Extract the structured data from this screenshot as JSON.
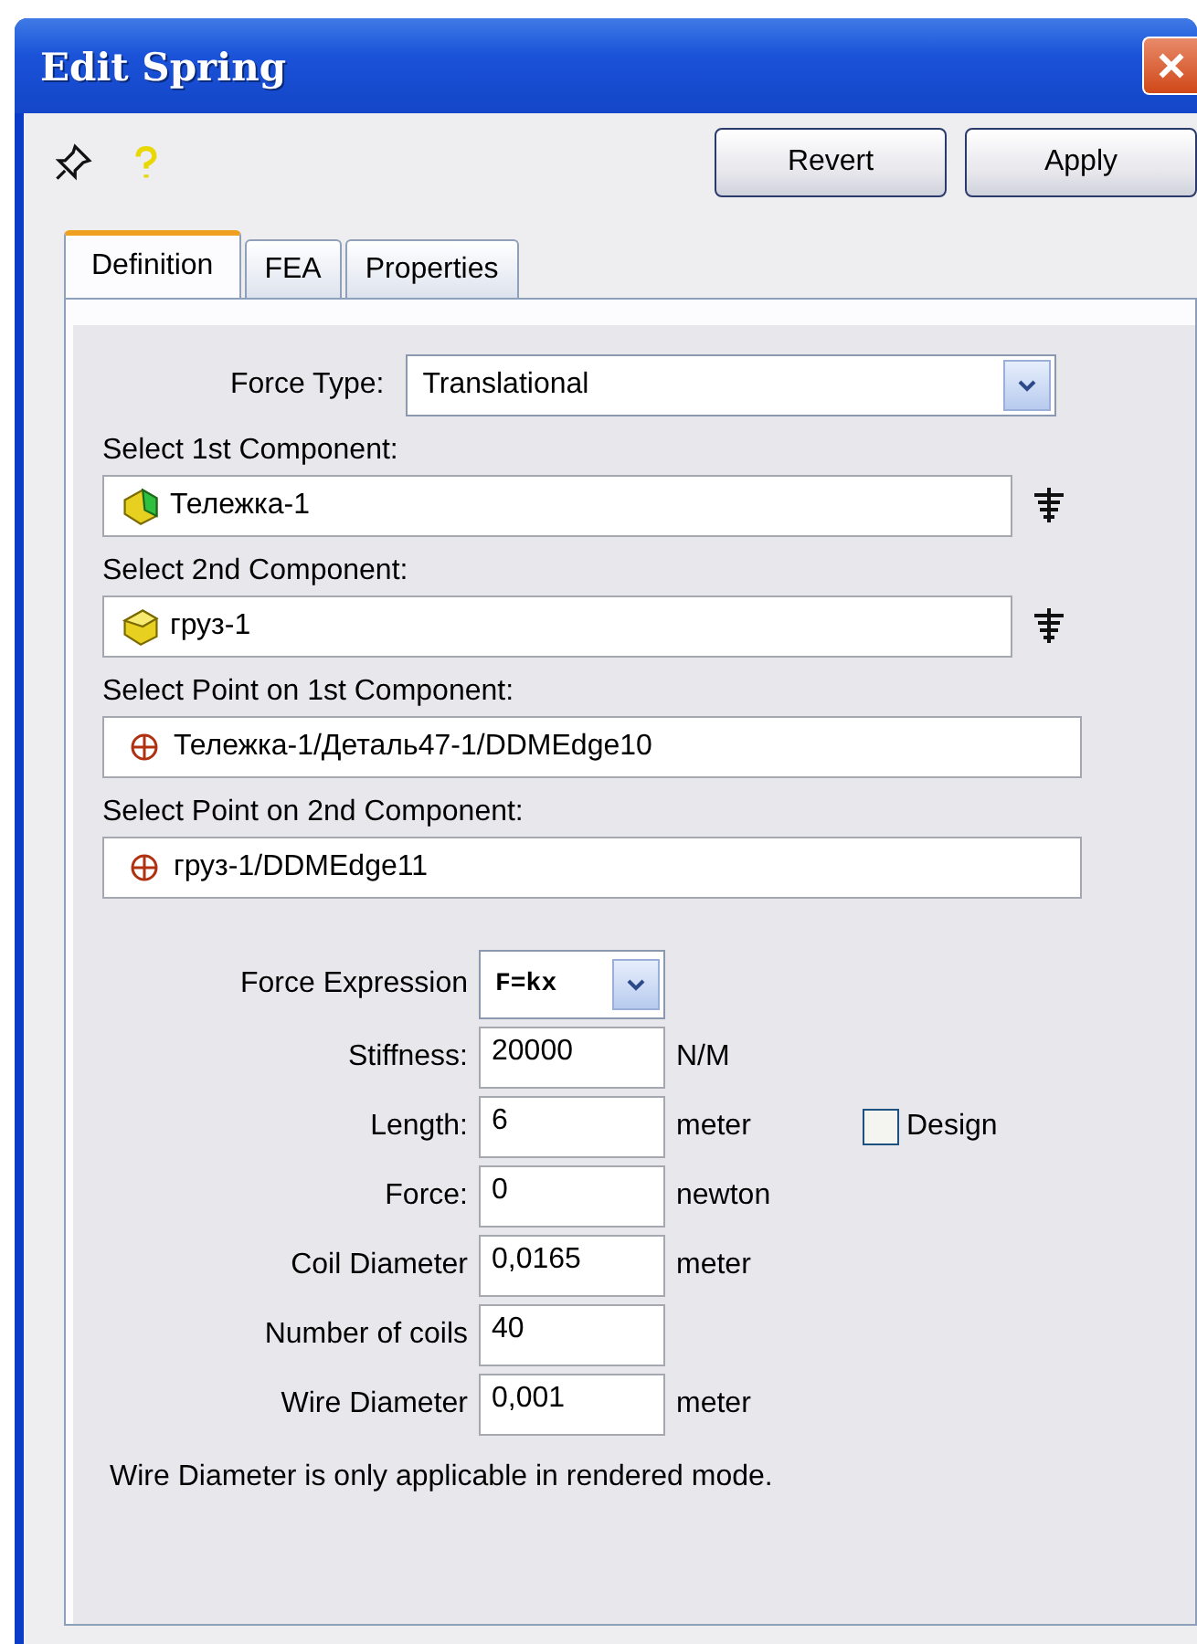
{
  "window": {
    "title": "Edit Spring"
  },
  "toolbar": {
    "buttons": [
      {
        "label": "Revert"
      },
      {
        "label": "Apply"
      }
    ]
  },
  "tabs": [
    {
      "label": "Definition",
      "selected": true
    },
    {
      "label": "FEA",
      "selected": false
    },
    {
      "label": "Properties",
      "selected": false
    }
  ],
  "force_type": {
    "label": "Force Type:",
    "value": "Translational"
  },
  "selections": [
    {
      "label": "Select 1st Component:",
      "value": "Тележка-1",
      "kind": "assembly"
    },
    {
      "label": "Select 2nd Component:",
      "value": "груз-1",
      "kind": "part"
    },
    {
      "label": "Select Point on 1st Component:",
      "value": "Тележка-1/Деталь47-1/DDMEdge10",
      "kind": "point"
    },
    {
      "label": "Select Point on 2nd Component:",
      "value": "груз-1/DDMEdge11",
      "kind": "point"
    }
  ],
  "force_expression": {
    "label": "Force Expression",
    "value": "F=kx"
  },
  "parameters": [
    {
      "label": "Stiffness:",
      "value": "20000",
      "unit": "N/M"
    },
    {
      "label": "Length:",
      "value": "6",
      "unit": "meter"
    },
    {
      "label": "Force:",
      "value": "0",
      "unit": "newton"
    },
    {
      "label": "Coil Diameter",
      "value": "0,0165",
      "unit": "meter"
    },
    {
      "label": "Number of coils",
      "value": "40"
    },
    {
      "label": "Wire Diameter",
      "value": "0,001",
      "unit": "meter"
    }
  ],
  "design_checkbox": {
    "label": "Design",
    "checked": false
  },
  "note": "Wire Diameter is only applicable in rendered mode."
}
